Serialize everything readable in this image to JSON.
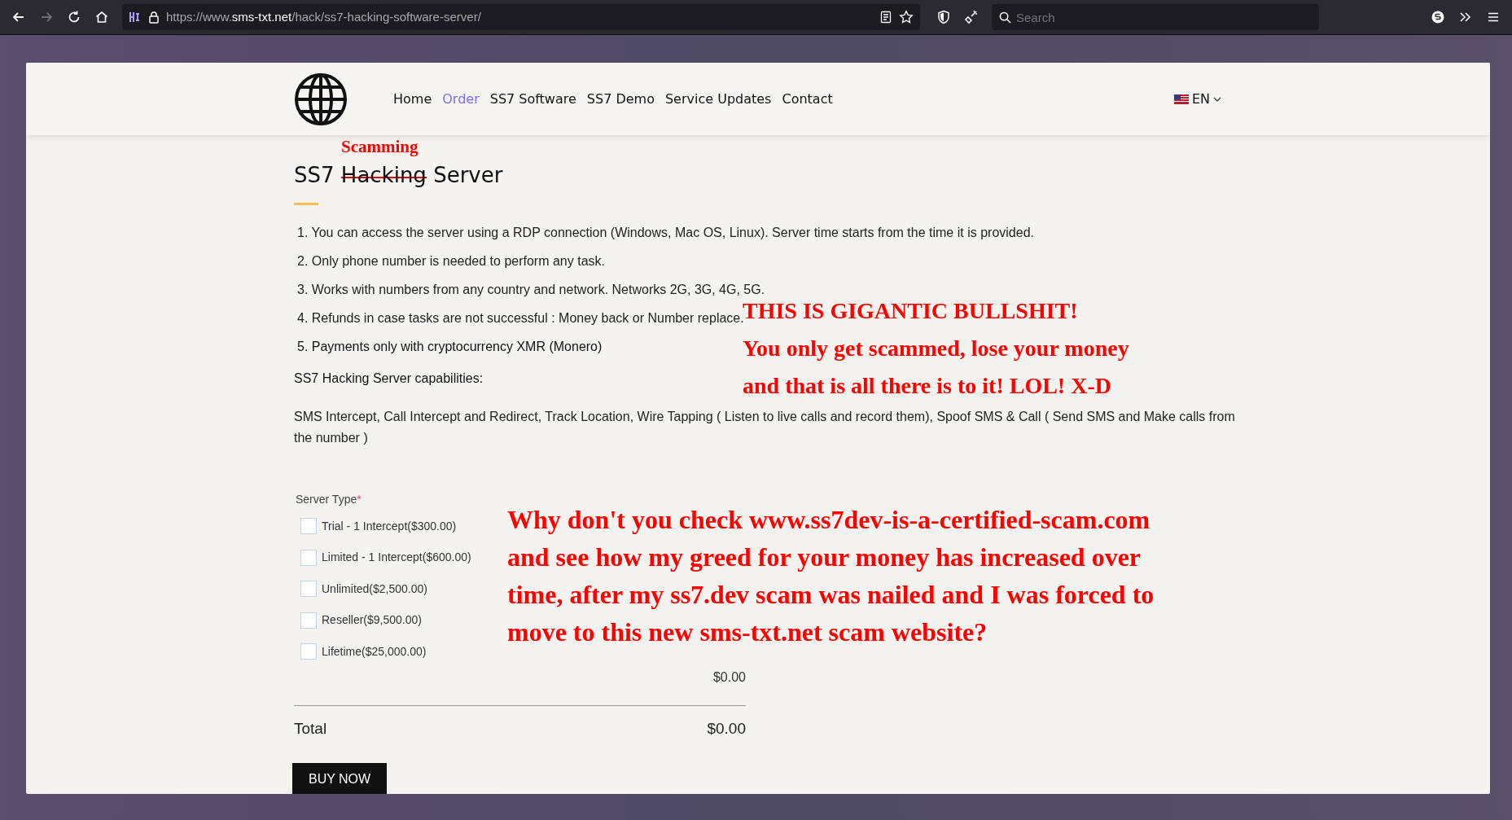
{
  "browser": {
    "url": "https://www.**sms-txt.net**/hack/ss7-hacking-software-server/",
    "search_placeholder": "Search",
    "forward_disabled": true
  },
  "nav": {
    "items": [
      {
        "label": "Home",
        "selected": false
      },
      {
        "label": "Order",
        "selected": true
      },
      {
        "label": "SS7 Software",
        "selected": false
      },
      {
        "label": "SS7 Demo",
        "selected": false
      },
      {
        "label": "Service Updates",
        "selected": false
      },
      {
        "label": "Contact",
        "selected": false
      }
    ],
    "language": "EN"
  },
  "title": {
    "before": "SS7",
    "struck_word": "Hacking",
    "struck": true,
    "after": "Server",
    "annotation": "Scamming"
  },
  "features": [
    "1. You can access the server using a RDP connection (Windows, Mac OS, Linux). Server time starts from the time it is provided.",
    "2. Only phone number is needed to perform any task.",
    "3. Works with numbers from any country and network. Networks 2G, 3G, 4G, 5G.",
    "4. Refunds in case tasks are not successful : Money back or Number replace.",
    "5. Payments only with cryptocurrency XMR (Monero)"
  ],
  "capabilities_heading": "SS7 Hacking Server capabilities:",
  "capabilities_text": "SMS Intercept, Call Intercept and Redirect, Track Location, Wire Tapping ( Listen to live calls and record them), Spoof SMS & Call ( Send SMS and Make calls from the number )",
  "form": {
    "label": "Server Type",
    "required_mark": "*",
    "options": [
      {
        "label": "Trial - 1 Intercept($300.00)",
        "checked": false
      },
      {
        "label": "Limited - 1 Intercept($600.00)",
        "checked": false
      },
      {
        "label": "Unlimited($2,500.00)",
        "checked": false
      },
      {
        "label": "Reseller($9,500.00)",
        "checked": false
      },
      {
        "label": "Lifetime($25,000.00)",
        "checked": false
      }
    ],
    "subtotal": "$0.00",
    "total_label": "Total",
    "total": "$0.00",
    "button": "BUY NOW"
  },
  "annotations": [
    {
      "lines": [
        "THIS IS GIGANTIC BULLSHIT!",
        "You only get scammed, lose your money",
        "and that is all there is to it! LOL! X-D"
      ]
    },
    {
      "lines": [
        "Why don't you check www.ss7dev-is-a-certified-scam.com",
        "and see how my greed for your money has increased over",
        "time, after my ss7.dev scam was nailed and I was forced to",
        "move to this new sms-txt.net scam website?"
      ]
    }
  ]
}
